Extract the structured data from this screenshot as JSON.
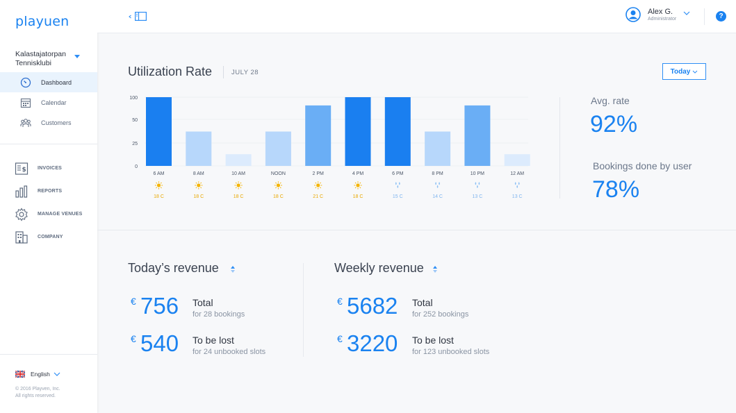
{
  "brand": {
    "logo": "playuen",
    "accent": "#1a82f0"
  },
  "club": {
    "name": "Kalastajatorpan Tennisklubi"
  },
  "nav": {
    "main": [
      {
        "label": "Dashboard",
        "icon": "dashboard-icon",
        "active": true
      },
      {
        "label": "Calendar",
        "icon": "calendar-icon"
      },
      {
        "label": "Customers",
        "icon": "customers-icon"
      }
    ],
    "secondary": [
      {
        "label": "INVOICES",
        "icon": "invoice-icon"
      },
      {
        "label": "REPORTS",
        "icon": "reports-icon"
      },
      {
        "label": "MANAGE VENUES",
        "icon": "gear-icon"
      },
      {
        "label": "COMPANY",
        "icon": "building-icon"
      }
    ]
  },
  "footer": {
    "language": "English",
    "copyright_line1": "© 2016 Playven, Inc.",
    "copyright_line2": "All rights reserved."
  },
  "user": {
    "name": "Alex G.",
    "role": "Administrator"
  },
  "utilization": {
    "title": "Utilization Rate",
    "date": "JULY 28",
    "filter": "Today",
    "avg_rate_label": "Avg. rate",
    "avg_rate_value": "92%",
    "bookings_label": "Bookings done by user",
    "bookings_value": "78%"
  },
  "chart_data": {
    "type": "bar",
    "categories": [
      "6 AM",
      "8 AM",
      "10 AM",
      "NOON",
      "2 PM",
      "4 PM",
      "6 PM",
      "8 PM",
      "10 PM",
      "12 AM"
    ],
    "values": [
      100,
      50,
      17,
      50,
      88,
      100,
      100,
      50,
      88,
      17
    ],
    "y_ticks": [
      "0",
      "25",
      "50",
      "100"
    ],
    "ylim": [
      0,
      100
    ],
    "weather": [
      {
        "icon": "sun-icon",
        "temp": "18 C"
      },
      {
        "icon": "sun-icon",
        "temp": "18 C"
      },
      {
        "icon": "sun-icon",
        "temp": "18 C"
      },
      {
        "icon": "sun-icon",
        "temp": "18 C"
      },
      {
        "icon": "sun-icon",
        "temp": "21 C"
      },
      {
        "icon": "sun-icon",
        "temp": "18 C"
      },
      {
        "icon": "rain-icon",
        "temp": "15 C"
      },
      {
        "icon": "rain-icon",
        "temp": "14 C"
      },
      {
        "icon": "rain-icon",
        "temp": "13 C"
      },
      {
        "icon": "rain-icon",
        "temp": "13 C"
      }
    ],
    "colors": {
      "full": "#1a7ff0",
      "high": "#6aaef5",
      "mid": "#b7d7fb",
      "low": "#dcebfd",
      "sun": "#f5b400",
      "rain": "#8ec1f5"
    }
  },
  "revenue": {
    "today": {
      "title": "Today’s revenue",
      "currency": "€",
      "total_amount": "756",
      "total_label": "Total",
      "total_sub": "for 28 bookings",
      "lost_amount": "540",
      "lost_label": "To be lost",
      "lost_sub": "for 24 unbooked slots"
    },
    "weekly": {
      "title": "Weekly revenue",
      "currency": "€",
      "total_amount": "5682",
      "total_label": "Total",
      "total_sub": "for 252 bookings",
      "lost_amount": "3220",
      "lost_label": "To be lost",
      "lost_sub": "for 123 unbooked slots"
    }
  }
}
